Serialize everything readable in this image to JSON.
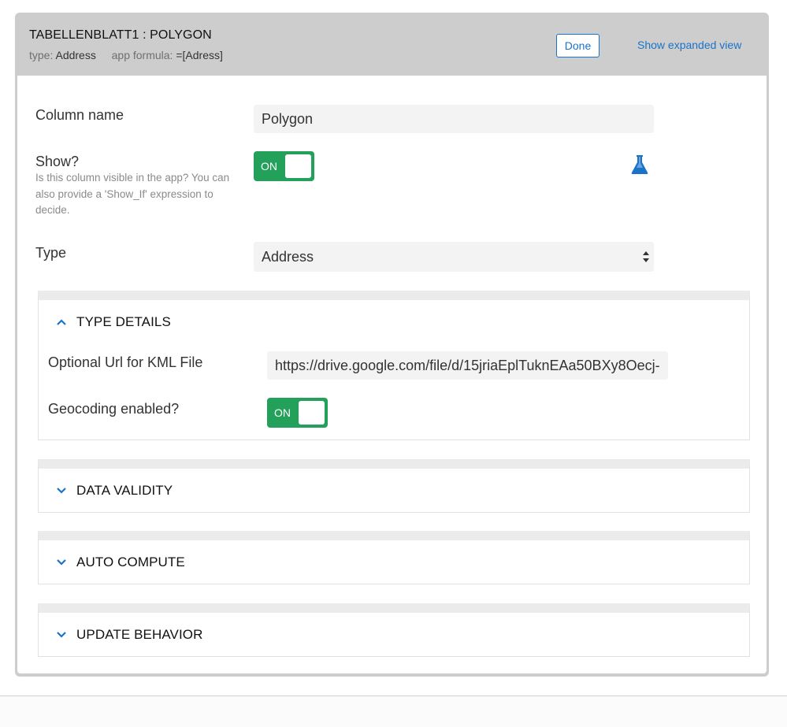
{
  "header": {
    "title": "TABELLENBLATT1 : POLYGON",
    "type_label": "type:",
    "type_value": "Address",
    "formula_label": "app formula:",
    "formula_value": "=[Adress]",
    "done_label": "Done",
    "expanded_label": "Show expanded view"
  },
  "column_name": {
    "label": "Column name",
    "value": "Polygon"
  },
  "show": {
    "label": "Show?",
    "help": "Is this column visible in the app? You can also provide a 'Show_If' expression to decide.",
    "toggle_label": "ON",
    "toggle_state": "on",
    "icon": "flask-icon"
  },
  "type": {
    "label": "Type",
    "value": "Address"
  },
  "type_details": {
    "title": "TYPE DETAILS",
    "expanded": true,
    "kml_label": "Optional Url for KML File",
    "kml_value": "https://drive.google.com/file/d/15jriaEplTuknEAa50BXy8Oecj-",
    "geocoding_label": "Geocoding enabled?",
    "geocoding_toggle_label": "ON",
    "geocoding_state": "on"
  },
  "sections": [
    {
      "title": "DATA VALIDITY",
      "expanded": false
    },
    {
      "title": "AUTO COMPUTE",
      "expanded": false
    },
    {
      "title": "UPDATE BEHAVIOR",
      "expanded": false
    }
  ],
  "colors": {
    "accent": "#1a73c8",
    "toggle_on": "#23a05a",
    "header_bg": "#cdcdcd"
  }
}
